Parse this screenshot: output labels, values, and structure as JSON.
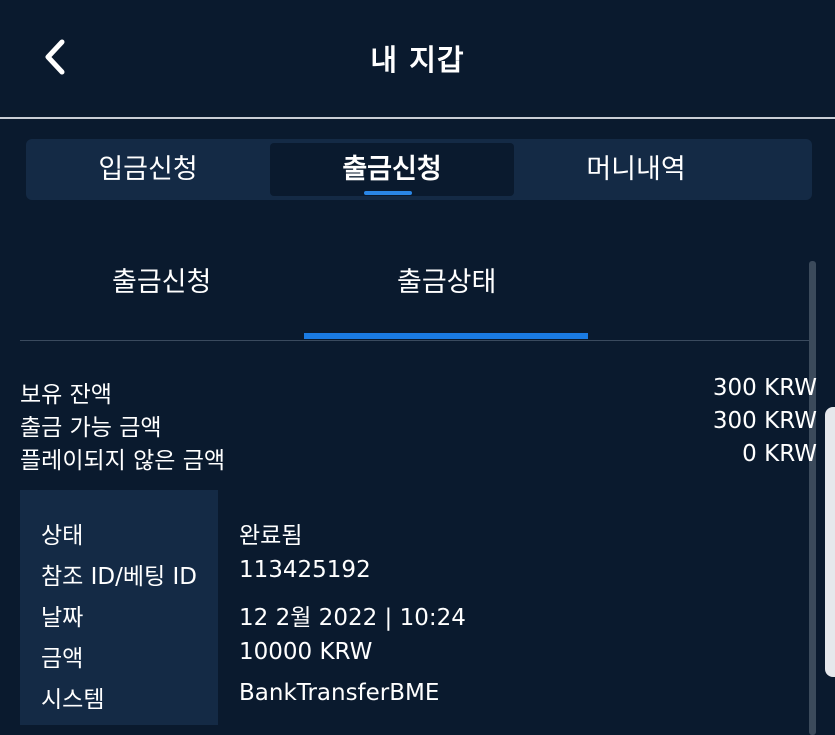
{
  "header": {
    "title": "내 지갑"
  },
  "tabs": [
    {
      "label": "입금신청",
      "active": false
    },
    {
      "label": "출금신청",
      "active": true
    },
    {
      "label": "머니내역",
      "active": false
    }
  ],
  "subtabs": [
    {
      "label": "출금신청",
      "active": false
    },
    {
      "label": "출금상태",
      "active": true
    }
  ],
  "balances": [
    {
      "label": "보유 잔액",
      "value": "300 KRW"
    },
    {
      "label": "출금 가능 금액",
      "value": "300 KRW"
    },
    {
      "label": "플레이되지 않은 금액",
      "value": "0 KRW"
    }
  ],
  "status": [
    {
      "label": "상태",
      "value": "완료됨"
    },
    {
      "label": "참조 ID/베팅 ID",
      "value": "113425192"
    },
    {
      "label": "날짜",
      "value": "12 2월 2022 | 10:24"
    },
    {
      "label": "금액",
      "value": "10000 KRW"
    },
    {
      "label": "시스템",
      "value": "BankTransferBME"
    }
  ],
  "colors": {
    "background": "#0a1a2e",
    "panel": "#142a45",
    "accent": "#1a7be3"
  }
}
